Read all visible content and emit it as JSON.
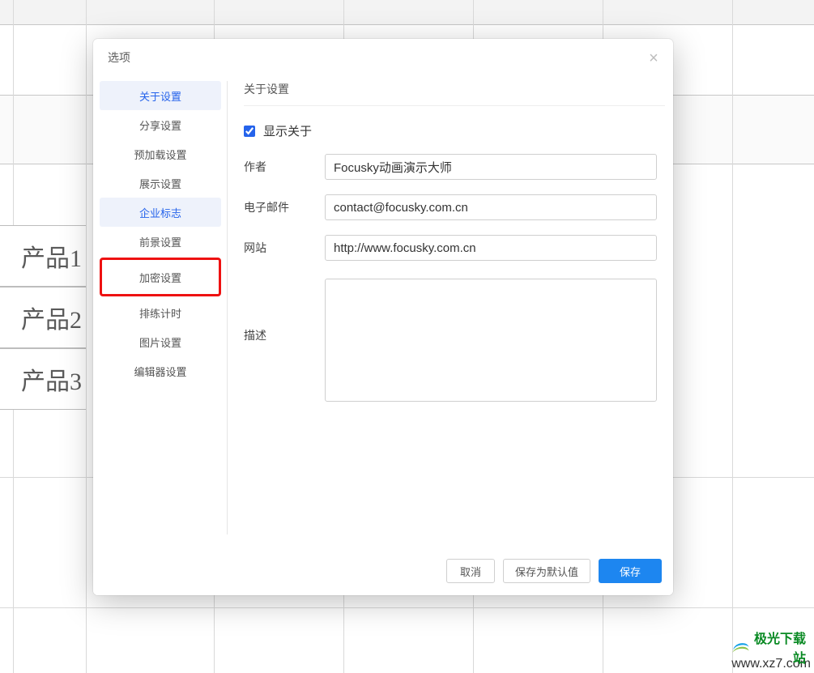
{
  "background": {
    "row_labels": [
      "产品1",
      "产品2",
      "产品3"
    ]
  },
  "modal": {
    "title": "选项",
    "close_glyph": "×"
  },
  "sidebar": {
    "items": [
      {
        "label": "关于设置",
        "state": "active"
      },
      {
        "label": "分享设置",
        "state": ""
      },
      {
        "label": "预加载设置",
        "state": ""
      },
      {
        "label": "展示设置",
        "state": ""
      },
      {
        "label": "企业标志",
        "state": "blue"
      },
      {
        "label": "前景设置",
        "state": ""
      },
      {
        "label": "加密设置",
        "state": "highlight-red"
      },
      {
        "label": "排练计时",
        "state": ""
      },
      {
        "label": "图片设置",
        "state": ""
      },
      {
        "label": "编辑器设置",
        "state": ""
      }
    ]
  },
  "panel": {
    "section_title": "关于设置",
    "show_about_label": "显示关于",
    "show_about_checked": true,
    "author_label": "作者",
    "author_value": "Focusky动画演示大师",
    "email_label": "电子邮件",
    "email_value": "contact@focusky.com.cn",
    "website_label": "网站",
    "website_value": "http://www.focusky.com.cn",
    "desc_label": "描述",
    "desc_value": ""
  },
  "footer": {
    "cancel": "取消",
    "save_default": "保存为默认值",
    "save": "保存"
  },
  "watermark": {
    "brand": "极光下载站",
    "url": "www.xz7.com"
  }
}
